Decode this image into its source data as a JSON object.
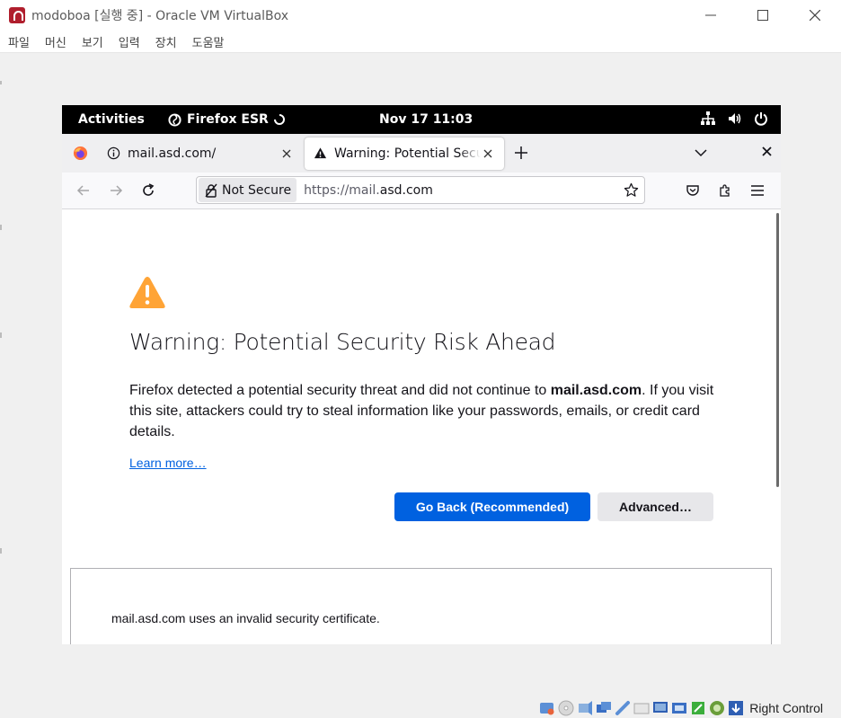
{
  "host": {
    "title": "modoboa [실행 중] - Oracle VM VirtualBox",
    "menu": [
      "파일",
      "머신",
      "보기",
      "입력",
      "장치",
      "도움말"
    ],
    "host_key": "Right Control"
  },
  "gnome": {
    "activities": "Activities",
    "app_name": "Firefox ESR",
    "clock": "Nov 17  11:03"
  },
  "tabs": [
    {
      "label": "mail.asd.com/",
      "active": false
    },
    {
      "label": "Warning: Potential Security Risk Ahead",
      "active": true
    }
  ],
  "urlbar": {
    "badge": "Not Secure",
    "url_prefix": "https://mail.",
    "url_host": "asd.com"
  },
  "page": {
    "title": "Warning: Potential Security Risk Ahead",
    "desc_pre": "Firefox detected a potential security threat and did not continue to ",
    "desc_host": "mail.asd.com",
    "desc_post": ". If you visit this site, attackers could try to steal information like your passwords, emails, or credit card details.",
    "learn_more": "Learn more…",
    "go_back": "Go Back (Recommended)",
    "advanced": "Advanced…",
    "advanced_text": "mail.asd.com uses an invalid security certificate."
  },
  "colors": {
    "primary_button": "#0061e0",
    "warning_icon": "#ffa436"
  }
}
